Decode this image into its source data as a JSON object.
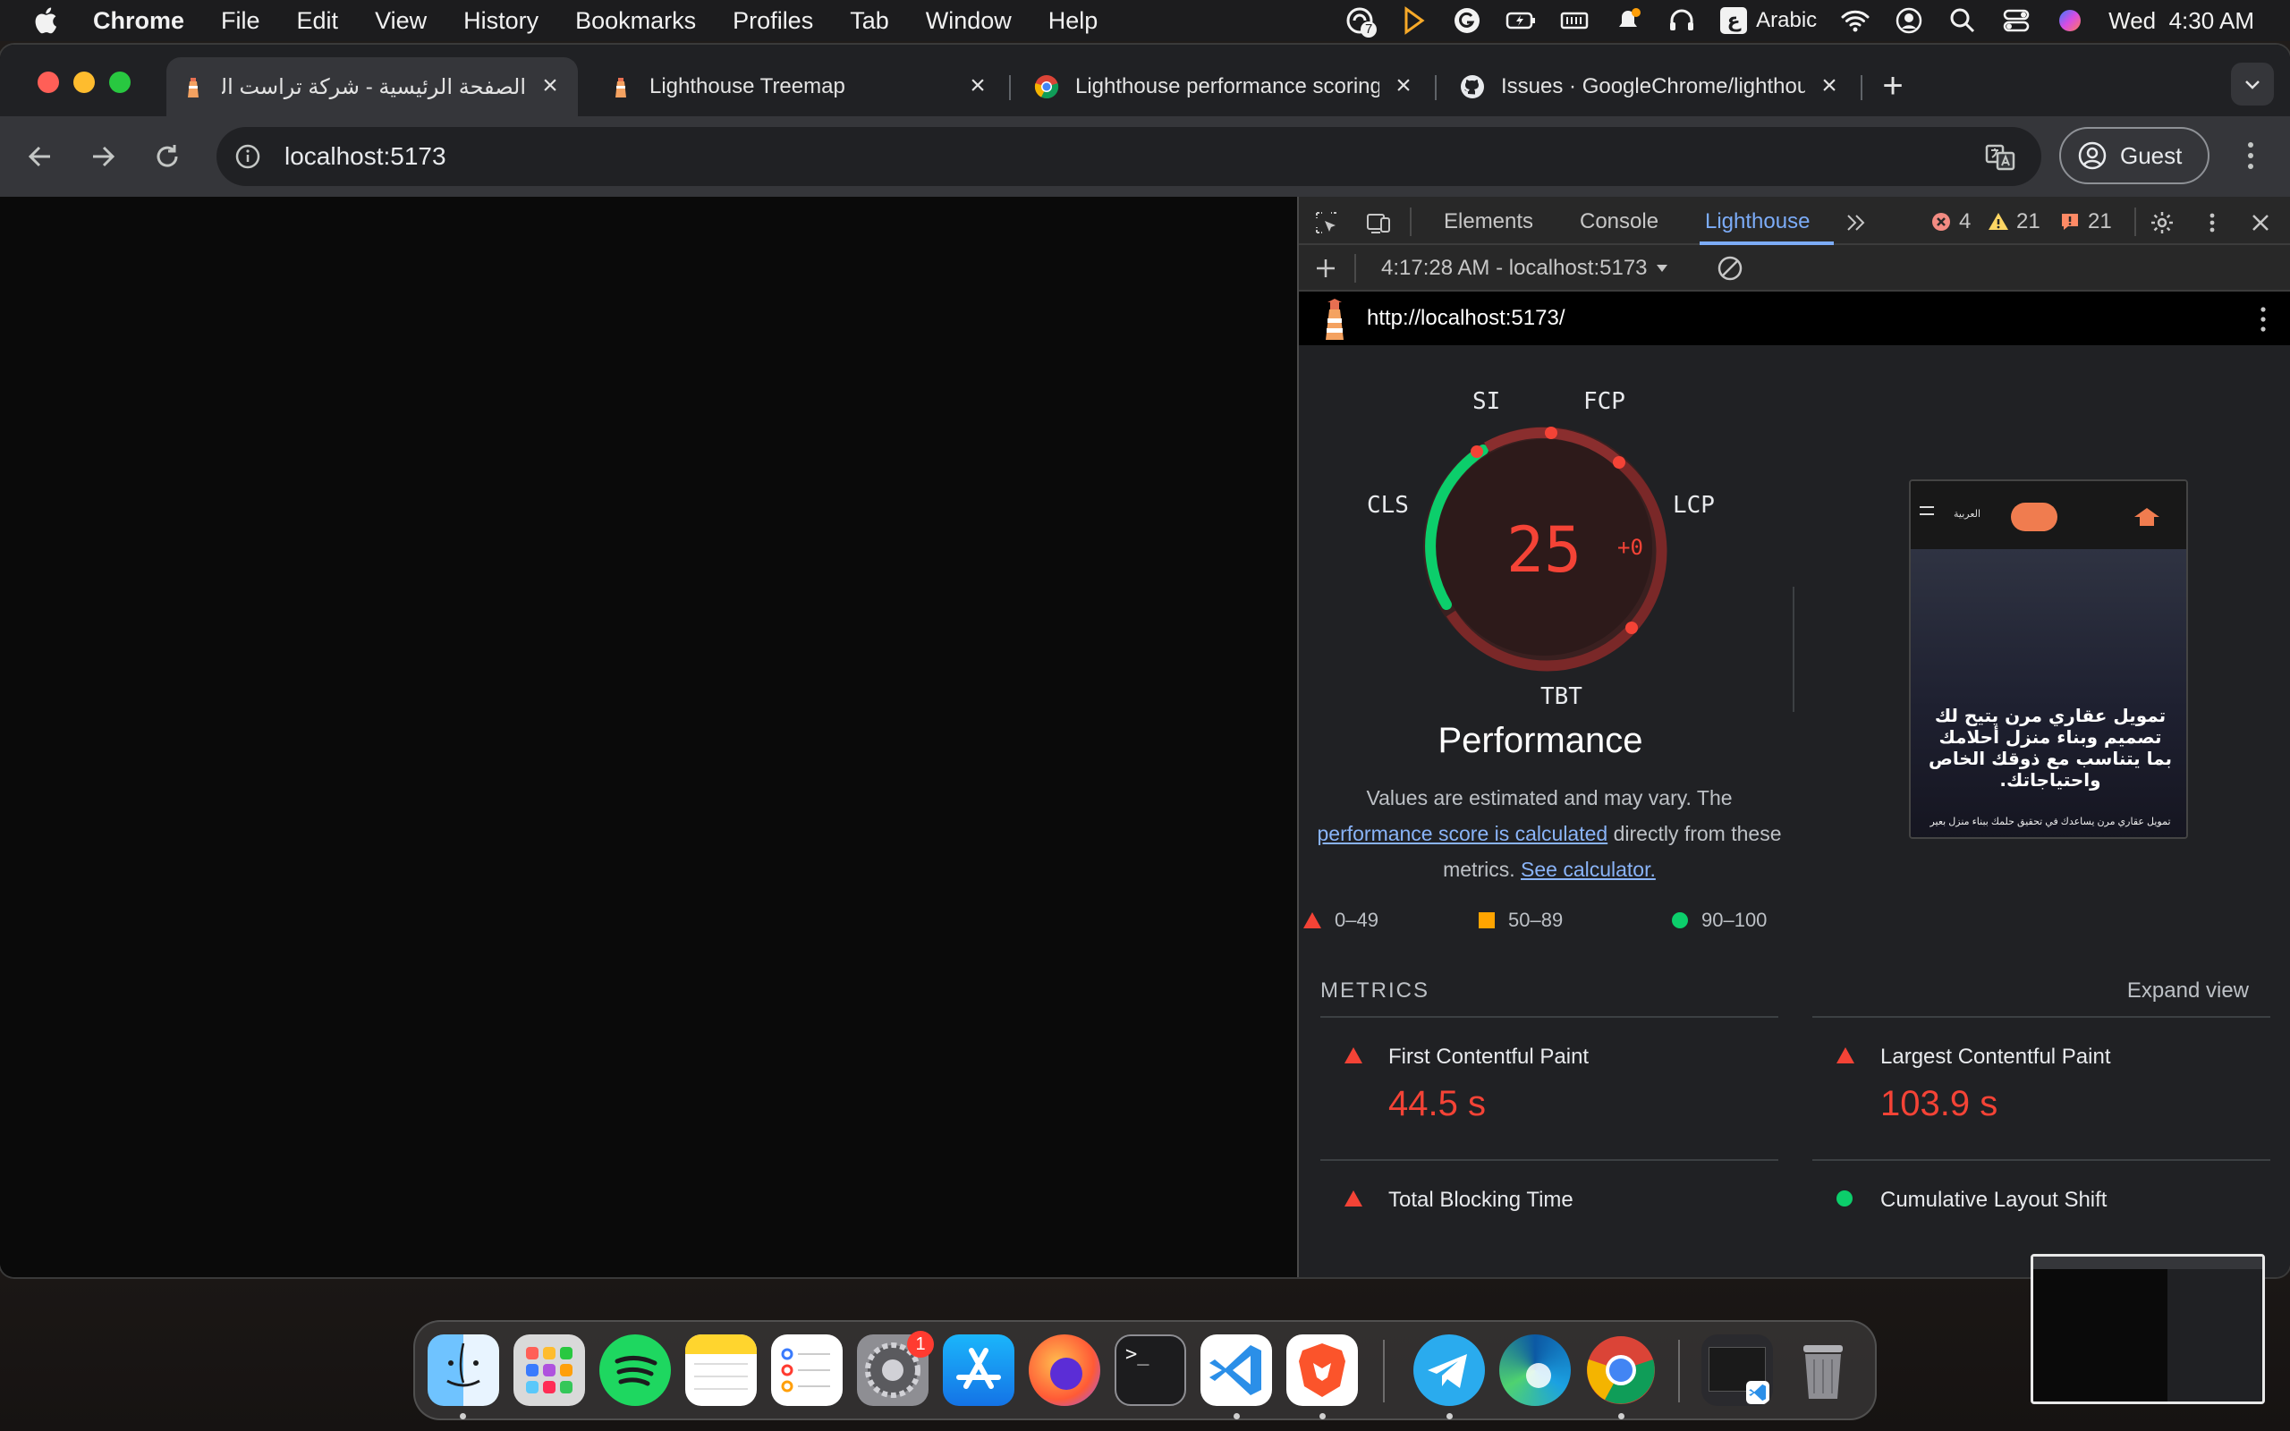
{
  "menubar": {
    "app_name": "Chrome",
    "items": [
      "File",
      "Edit",
      "View",
      "History",
      "Bookmarks",
      "Profiles",
      "Tab",
      "Window",
      "Help"
    ],
    "input_source": "Arabic",
    "input_source_glyph": "ع",
    "clock": "Wed  4:30 AM",
    "notification_count": "7"
  },
  "tabs": [
    {
      "title": "الصفحة الرئيسية - شركة تراست العقارية",
      "active": true
    },
    {
      "title": "Lighthouse Treemap",
      "active": false
    },
    {
      "title": "Lighthouse performance scoring",
      "active": false
    },
    {
      "title": "Issues · GoogleChrome/lighthouse",
      "active": false
    }
  ],
  "omnibox": {
    "url": "localhost:5173"
  },
  "profile": {
    "label": "Guest"
  },
  "devtools": {
    "tabs": [
      "Elements",
      "Console",
      "Lighthouse"
    ],
    "active_tab": "Lighthouse",
    "errors": "4",
    "warnings": "21",
    "issues": "21",
    "report_selector": "4:17:28 AM - localhost:5173",
    "report_url": "http://localhost:5173/"
  },
  "performance": {
    "score": "25",
    "delta": "+0",
    "title": "Performance",
    "desc_before": "Values are estimated and may vary. The ",
    "desc_link1": "performance score is calculated",
    "desc_middle": " directly from these metrics. ",
    "desc_link2": "See calculator.",
    "gauge_labels": {
      "si": "SI",
      "fcp": "FCP",
      "lcp": "LCP",
      "tbt": "TBT",
      "cls": "CLS"
    },
    "legend": {
      "poor": "0–49",
      "average": "50–89",
      "good": "90–100"
    },
    "colors": {
      "poor": "#f44336",
      "average": "#ffa400",
      "good": "#0cce6b"
    }
  },
  "screenshot": {
    "language": "العربية",
    "headline": "تمويل عقاري مرن يتيح لك تصميم وبناء منزل أحلامك بما يتناسب مع ذوقك الخاص واحتياجاتك.",
    "subline": "تمويل عقاري مرن يساعدك في تحقيق حلمك ببناء منزل بعير"
  },
  "metrics": {
    "heading": "METRICS",
    "expand": "Expand view",
    "items": [
      {
        "name": "First Contentful Paint",
        "value": "44.5 s",
        "status": "poor"
      },
      {
        "name": "Largest Contentful Paint",
        "value": "103.9 s",
        "status": "poor"
      },
      {
        "name": "Total Blocking Time",
        "value": "",
        "status": "poor"
      },
      {
        "name": "Cumulative Layout Shift",
        "value": "",
        "status": "good"
      }
    ]
  },
  "dock": {
    "apps": [
      "finder-icon",
      "launchpad-icon",
      "spotify-icon",
      "notes-icon",
      "reminders-icon",
      "system-settings-icon",
      "app-store-icon",
      "firefox-icon",
      "terminal-icon",
      "vscode-icon",
      "brave-icon",
      "telegram-icon",
      "edge-icon",
      "chrome-icon",
      "trash-icon"
    ],
    "settings_badge": "1",
    "terminal_prompt": ">_"
  }
}
